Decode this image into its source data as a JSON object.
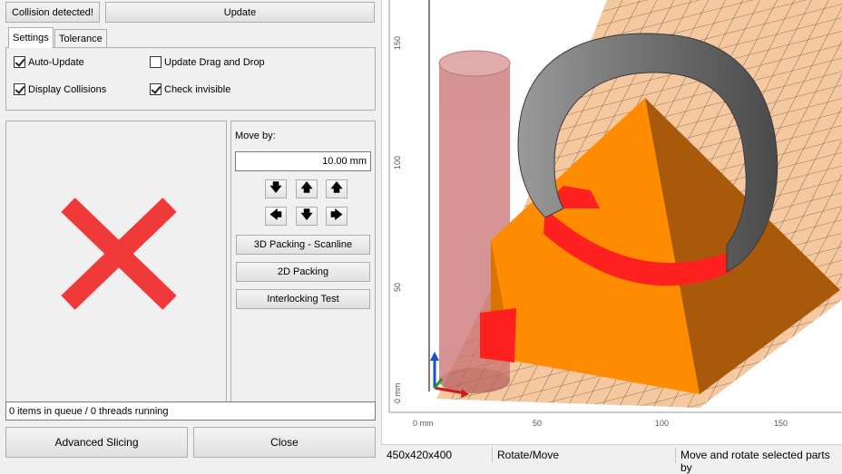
{
  "toolbar": {
    "collision_label": "Collision detected!",
    "update_label": "Update"
  },
  "tabs": [
    {
      "label": "Settings",
      "active": true
    },
    {
      "label": "Tolerance",
      "active": false
    }
  ],
  "settings": {
    "auto_update": {
      "label": "Auto-Update",
      "checked": true
    },
    "update_drag_drop": {
      "label": "Update Drag and Drop",
      "checked": false
    },
    "display_collisions": {
      "label": "Display Collisions",
      "checked": true
    },
    "check_invisible": {
      "label": "Check invisible",
      "checked": true
    }
  },
  "move": {
    "label": "Move by:",
    "value": "10.00 mm",
    "packing_scanline": "3D Packing - Scanline",
    "packing_2d": "2D Packing",
    "interlocking": "Interlocking Test"
  },
  "queue_status": "0 items in queue / 0 threads running",
  "footer": {
    "advanced_slicing": "Advanced Slicing",
    "close": "Close"
  },
  "viewport": {
    "ruler_v": [
      "150",
      "100",
      "50",
      "0 mm"
    ],
    "ruler_h": [
      "0 mm",
      "50",
      "100",
      "150"
    ]
  },
  "statusbar": {
    "dimensions": "450x420x400",
    "mode": "Rotate/Move",
    "hint": "Move and rotate selected parts by"
  },
  "colors": {
    "collision_red": "#ff2020",
    "object_orange": "#ff8c00",
    "platform": "#f5c8a0",
    "x_mark": "#f03a3a"
  }
}
